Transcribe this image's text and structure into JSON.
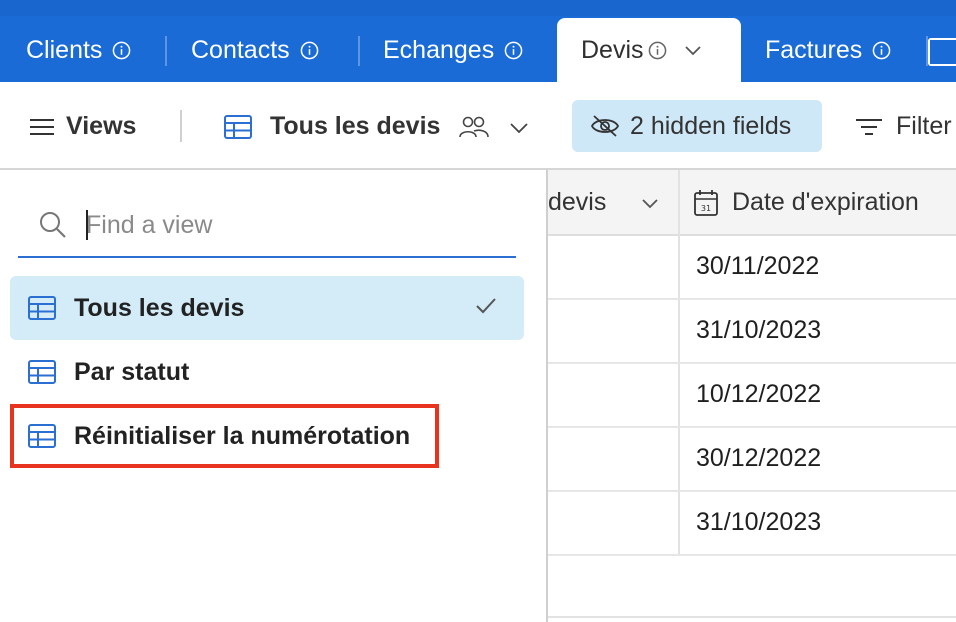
{
  "tabs": [
    {
      "label": "Clients",
      "active": false
    },
    {
      "label": "Contacts",
      "active": false
    },
    {
      "label": "Echanges",
      "active": false
    },
    {
      "label": "Devis",
      "active": true
    },
    {
      "label": "Factures",
      "active": false
    }
  ],
  "toolbar": {
    "views_label": "Views",
    "current_view": "Tous les devis",
    "hidden_fields_label": "2 hidden fields",
    "filter_label": "Filter"
  },
  "views_dropdown": {
    "search_placeholder": "Find a view",
    "items": [
      {
        "label": "Tous les devis",
        "selected": true
      },
      {
        "label": "Par statut",
        "selected": false
      },
      {
        "label": "Réinitialiser la numérotation",
        "selected": false,
        "highlighted": true
      }
    ]
  },
  "grid": {
    "columns": [
      "devis",
      "Date d'expiration"
    ],
    "rows": [
      {
        "date_expiration": "30/11/2022"
      },
      {
        "date_expiration": "31/10/2023"
      },
      {
        "date_expiration": "10/12/2022"
      },
      {
        "date_expiration": "30/12/2022"
      },
      {
        "date_expiration": "31/10/2023"
      }
    ]
  },
  "colors": {
    "tabbar": "#1a6bd6",
    "selected_view_bg": "#d3ecf8",
    "hidden_fields_bg": "#cfe8f7",
    "highlight_border": "#e8331f",
    "grid_icon": "#2a6fd1"
  }
}
